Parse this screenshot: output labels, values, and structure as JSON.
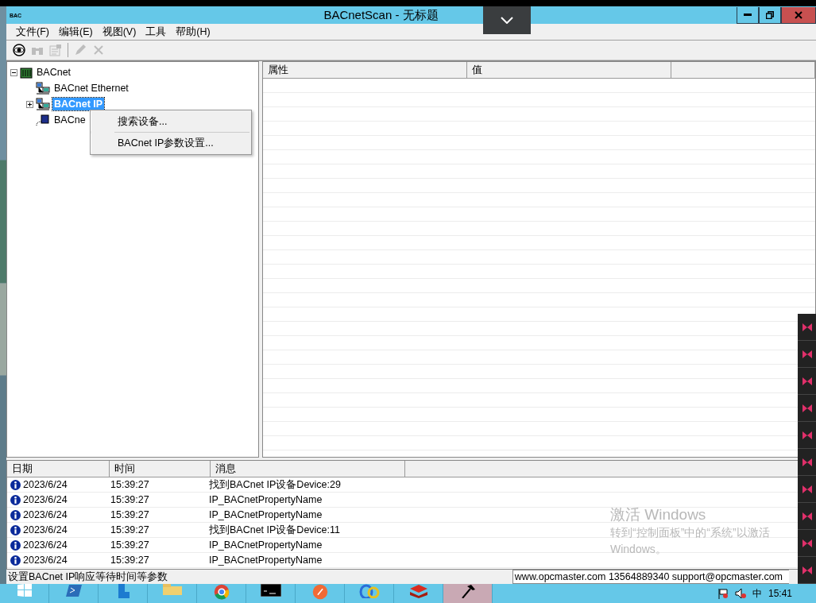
{
  "window": {
    "icon_text": "BAC",
    "title": "BACnetScan - 无标题"
  },
  "menu": [
    "文件(F)",
    "编辑(E)",
    "视图(V)",
    "工具",
    "帮助(H)"
  ],
  "toolbar": [
    {
      "kind": "eye",
      "disabled": false
    },
    {
      "kind": "binoculars",
      "disabled": true
    },
    {
      "kind": "properties",
      "disabled": true
    },
    {
      "kind": "separator"
    },
    {
      "kind": "pencil",
      "disabled": true
    },
    {
      "kind": "delete",
      "disabled": true
    }
  ],
  "tree": [
    {
      "label": "BACnet",
      "kind": "root",
      "expanded": true,
      "selected": false,
      "children": [
        {
          "label": "BACnet Ethernet",
          "kind": "network",
          "selected": false
        },
        {
          "label": "BACnet IP",
          "kind": "network",
          "expanded": false,
          "selected": true
        },
        {
          "label": "BACne",
          "kind": "serial",
          "selected": false
        }
      ]
    }
  ],
  "context_menu": {
    "items": [
      "搜索设备...",
      "BACnet IP参数设置..."
    ]
  },
  "property_table": {
    "columns": [
      "属性",
      "值"
    ]
  },
  "log": {
    "columns": [
      "日期",
      "时间",
      "消息"
    ],
    "rows": [
      {
        "date": "2023/6/24",
        "time": "15:39:27",
        "message": "找到BACnet IP设备Device:29"
      },
      {
        "date": "2023/6/24",
        "time": "15:39:27",
        "message": "IP_BACnetPropertyName"
      },
      {
        "date": "2023/6/24",
        "time": "15:39:27",
        "message": "IP_BACnetPropertyName"
      },
      {
        "date": "2023/6/24",
        "time": "15:39:27",
        "message": "找到BACnet IP设备Device:11"
      },
      {
        "date": "2023/6/24",
        "time": "15:39:27",
        "message": "IP_BACnetPropertyName"
      },
      {
        "date": "2023/6/24",
        "time": "15:39:27",
        "message": "IP_BACnetPropertyName"
      }
    ]
  },
  "status_bar": {
    "hint": "设置BACnet IP响应等待时间等参数",
    "contact": "www.opcmaster.com 13564889340 support@opcmaster.com"
  },
  "activation_notice": {
    "title": "激活 Windows",
    "lines": [
      "转到“控制面板”中的“系统”以激活",
      "Windows。"
    ]
  },
  "taskbar": {
    "apps": [
      {
        "kind": "start",
        "selected": false
      },
      {
        "kind": "powershell",
        "selected": false
      },
      {
        "kind": "server",
        "selected": false
      },
      {
        "kind": "folder",
        "selected": false
      },
      {
        "kind": "chrome",
        "selected": false
      },
      {
        "kind": "terminal",
        "selected": false
      },
      {
        "kind": "orange",
        "selected": false
      },
      {
        "kind": "loops",
        "selected": false
      },
      {
        "kind": "redis",
        "selected": false
      },
      {
        "kind": "hammer",
        "selected": true
      }
    ],
    "language": "中",
    "clock": "15:41"
  }
}
